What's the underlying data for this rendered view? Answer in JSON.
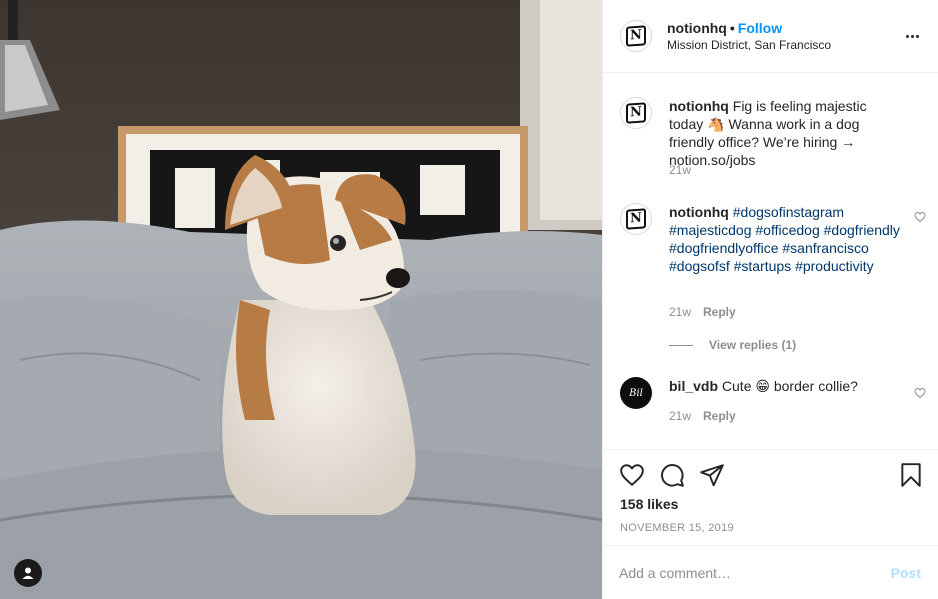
{
  "post": {
    "username": "notionhq",
    "follow_label": "Follow",
    "separator": "•",
    "location": "Mission District, San Francisco",
    "caption": {
      "username": "notionhq",
      "text": "Fig is feeling majestic today 🐴 Wanna work in a dog friendly office? We’re hiring → notion.so/jobs",
      "time": "21w"
    },
    "comments": [
      {
        "username": "notionhq",
        "text": "#dogsofinstagram #majesticdog #officedog #dogfriendly #dogfriendlyoffice #sanfrancisco #dogsofsf #startups #productivity",
        "time": "21w",
        "reply_label": "Reply",
        "view_replies": "View replies (1)"
      },
      {
        "username": "bil_vdb",
        "text": "Cute 😁 border collie?",
        "time": "21w",
        "reply_label": "Reply"
      }
    ],
    "likes": "158 likes",
    "date": "NOVEMBER 15, 2019",
    "comment_placeholder": "Add a comment…",
    "post_label": "Post"
  },
  "icons": {
    "avatar_logo": "N",
    "bil_avatar_text": "Bil"
  },
  "colors": {
    "accent": "#0095f6",
    "post_disabled": "#b2dffc",
    "hashtag": "#00376b",
    "muted": "#8e8e8e"
  }
}
